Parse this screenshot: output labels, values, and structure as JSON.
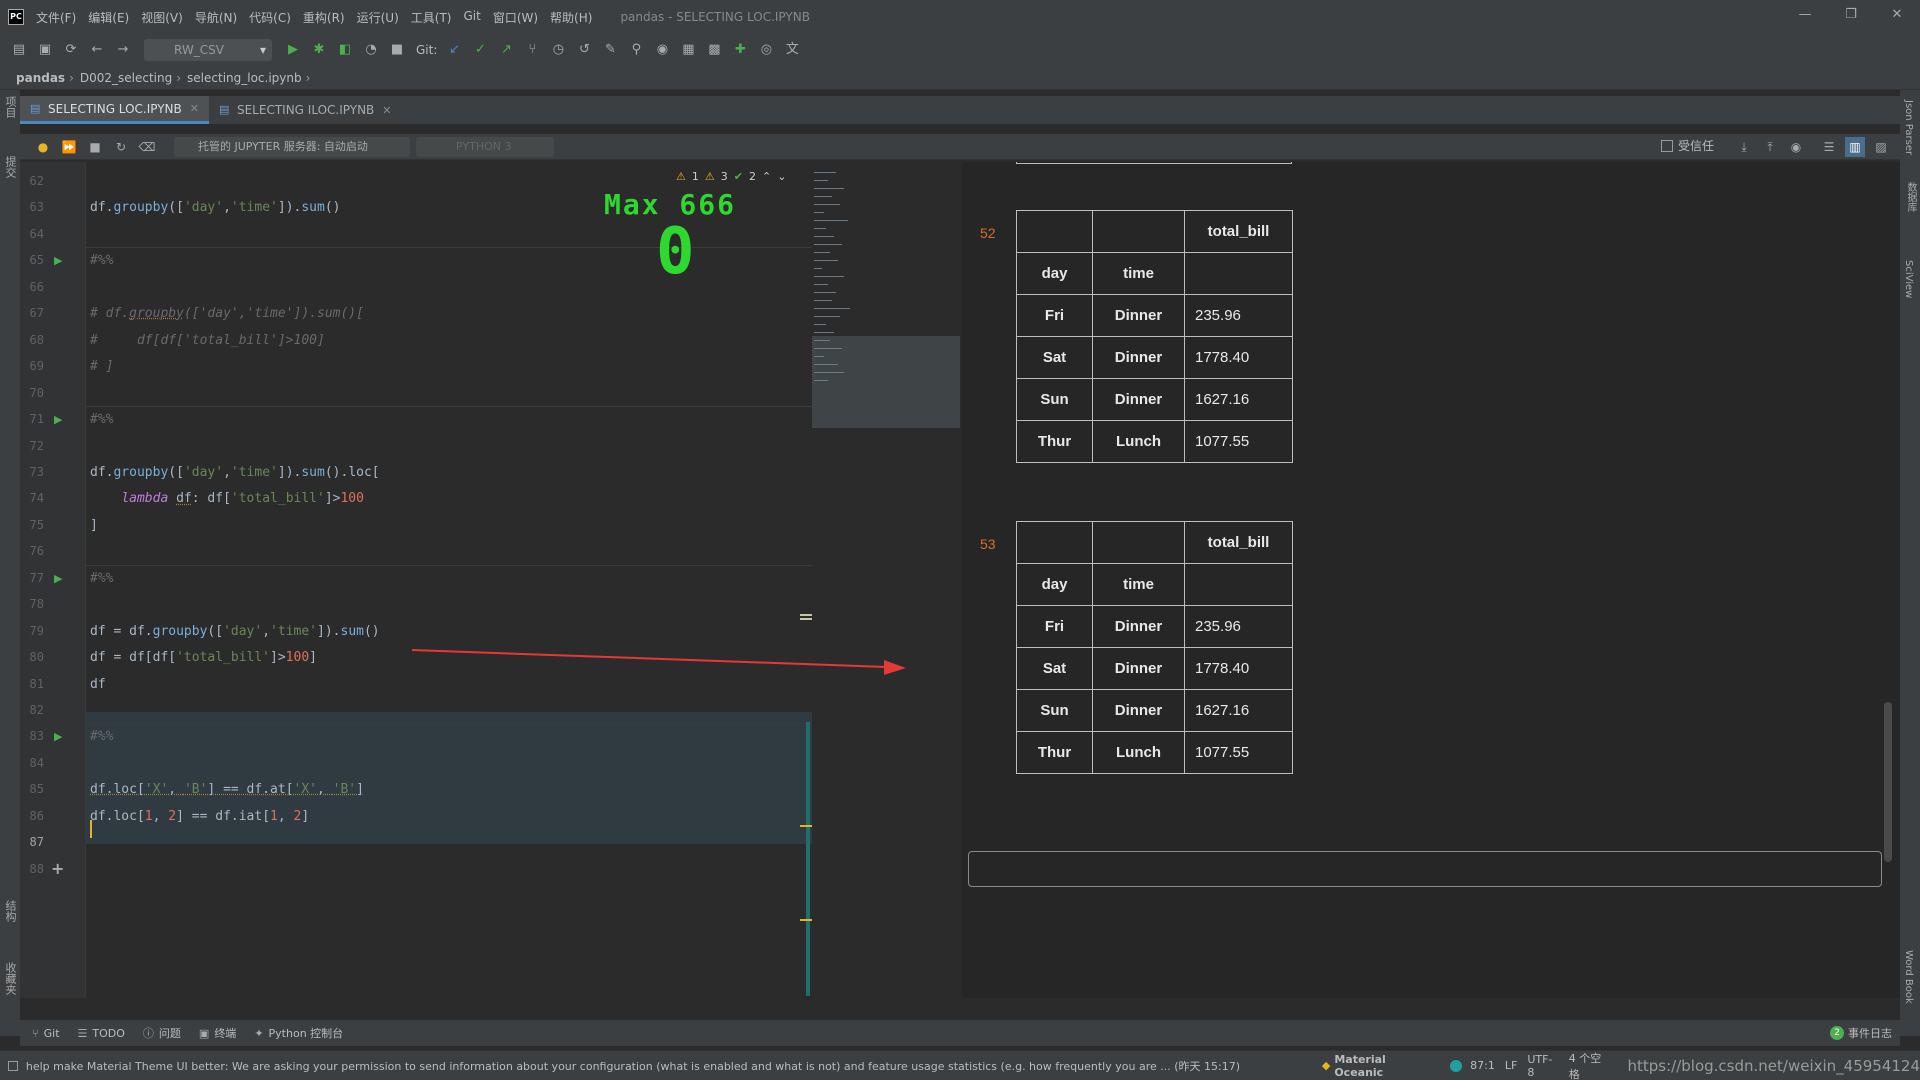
{
  "app": {
    "window_title": "pandas - SELECTING LOC.IPYNB",
    "menu": [
      "文件(F)",
      "编辑(E)",
      "视图(V)",
      "导航(N)",
      "代码(C)",
      "重构(R)",
      "运行(U)",
      "工具(T)",
      "Git",
      "窗口(W)",
      "帮助(H)"
    ]
  },
  "toolbar": {
    "run_config": "RW_CSV",
    "git_label": "Git:"
  },
  "breadcrumb": [
    "pandas",
    "D002_selecting",
    "selecting_loc.ipynb"
  ],
  "tabs": [
    {
      "label": "SELECTING LOC.IPYNB",
      "active": true
    },
    {
      "label": "SELECTING ILOC.IPYNB",
      "active": false
    }
  ],
  "notebook_toolbar": {
    "jupyter_server": "托管的 JUPYTER 服务器: 自动启动",
    "kernel": "PYTHON 3",
    "trusted_label": "受信任"
  },
  "left_strip": {
    "project": "项目",
    "commit": "提交",
    "structure": "结构",
    "favorites": "收藏夹"
  },
  "right_strip": {
    "json_parser": "Json Parser",
    "database": "数据库",
    "sciview": "SciView",
    "word_book": "Word Book"
  },
  "inspections": {
    "warn_a": "1",
    "warn_b": "3",
    "ok": "2"
  },
  "overlay": {
    "label": "Max 666",
    "value": "0"
  },
  "editor": {
    "lines": [
      {
        "n": "62",
        "html": ""
      },
      {
        "n": "63",
        "html": "df.<span class=\"fn\">groupby</span>([<span class=\"st\">'day'</span>,<span class=\"st\">'time'</span>]).<span class=\"fn\">sum</span>()"
      },
      {
        "n": "64",
        "html": ""
      },
      {
        "n": "65",
        "html": "<span class=\"cm\">#%%</span>",
        "run": true
      },
      {
        "n": "66",
        "html": ""
      },
      {
        "n": "67",
        "html": "<span class=\"cm\"># df.<span class=\"sq\">groupby</span>(['day','time']).sum()[</span>"
      },
      {
        "n": "68",
        "html": "<span class=\"cm\">#     df[df['total_bill']&gt;100]</span>"
      },
      {
        "n": "69",
        "html": "<span class=\"cm\"># ]</span>"
      },
      {
        "n": "70",
        "html": ""
      },
      {
        "n": "71",
        "html": "<span class=\"cm\">#%%</span>",
        "run": true
      },
      {
        "n": "72",
        "html": ""
      },
      {
        "n": "73",
        "html": "df.<span class=\"fn\">groupby</span>([<span class=\"st\">'day'</span>,<span class=\"st\">'time'</span>]).<span class=\"fn\">sum</span>().loc["
      },
      {
        "n": "74",
        "html": "    <span class=\"kw\">lambda</span> <span class=\"sq\">df</span>: df[<span class=\"st\">'total_bill'</span>]&gt;<span class=\"nm\">100</span>"
      },
      {
        "n": "75",
        "html": "]"
      },
      {
        "n": "76",
        "html": ""
      },
      {
        "n": "77",
        "html": "<span class=\"cm\">#%%</span>",
        "run": true
      },
      {
        "n": "78",
        "html": ""
      },
      {
        "n": "79",
        "html": "df = df.<span class=\"fn\">groupby</span>([<span class=\"st\">'day'</span>,<span class=\"st\">'time'</span>]).<span class=\"fn\">sum</span>()"
      },
      {
        "n": "80",
        "html": "df = df[df[<span class=\"st\">'total_bill'</span>]&gt;<span class=\"nm\">100</span>]"
      },
      {
        "n": "81",
        "html": "df"
      },
      {
        "n": "82",
        "html": ""
      },
      {
        "n": "83",
        "html": "<span class=\"cm\">#%%</span>",
        "run": true
      },
      {
        "n": "84",
        "html": ""
      },
      {
        "n": "85",
        "html": "<span class=\"sq\">df.loc[<span class=\"st\">'X'</span>, <span class=\"st\">'B'</span>] == df.at[<span class=\"st\">'X'</span>, <span class=\"st\">'B'</span>]</span>"
      },
      {
        "n": "86",
        "html": "df.loc[<span class=\"nm\">1</span>, <span class=\"nm\">2</span>] == df.iat[<span class=\"nm\">1</span>, <span class=\"nm\">2</span>]"
      },
      {
        "n": "87",
        "html": "",
        "current": true
      },
      {
        "n": "88",
        "html": "",
        "add": true
      }
    ]
  },
  "outputs": [
    {
      "number": "52",
      "header_col": "total_bill",
      "index_names": [
        "day",
        "time"
      ],
      "rows": [
        [
          "Fri",
          "Dinner",
          "235.96"
        ],
        [
          "Sat",
          "Dinner",
          "1778.40"
        ],
        [
          "Sun",
          "Dinner",
          "1627.16"
        ],
        [
          "Thur",
          "Lunch",
          "1077.55"
        ]
      ]
    },
    {
      "number": "53",
      "header_col": "total_bill",
      "index_names": [
        "day",
        "time"
      ],
      "rows": [
        [
          "Fri",
          "Dinner",
          "235.96"
        ],
        [
          "Sat",
          "Dinner",
          "1778.40"
        ],
        [
          "Sun",
          "Dinner",
          "1627.16"
        ],
        [
          "Thur",
          "Lunch",
          "1077.55"
        ]
      ]
    }
  ],
  "bottom_tools": [
    {
      "label": "Git",
      "icon": "git-icon"
    },
    {
      "label": "TODO",
      "icon": "todo-icon"
    },
    {
      "label": "问题",
      "icon": "problems-icon"
    },
    {
      "label": "终端",
      "icon": "terminal-icon"
    },
    {
      "label": "Python 控制台",
      "icon": "python-console-icon"
    }
  ],
  "event_log": {
    "count": "2",
    "label": "事件日志"
  },
  "status": {
    "message": "help make Material Theme UI better: We are asking your permission to send information about your configuration (what is enabled and what is not) and feature usage statistics (e.g. how frequently you are ... (昨天 15:17)",
    "theme": "Material Oceanic",
    "position": "87:1",
    "line_sep": "LF",
    "encoding": "UTF-8",
    "indent": "4 个空格",
    "url": "https://blog.csdn.net/weixin_45954124"
  },
  "colors": {
    "accent": "#4a88c7",
    "run": "#4caf50",
    "output_number": "#d56e2e",
    "arrow": "#e53935",
    "overlay": "#2ed82e"
  }
}
